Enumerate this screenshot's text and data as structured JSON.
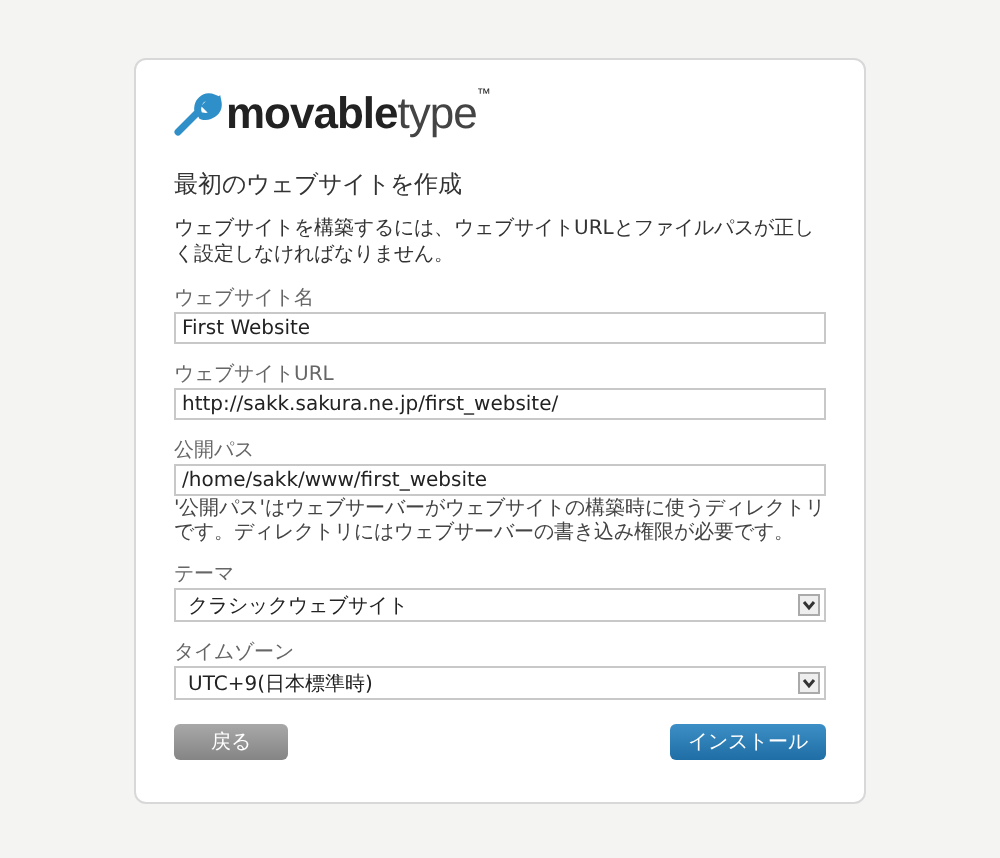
{
  "logo": {
    "strong": "movable",
    "light": "type",
    "mark": "™"
  },
  "heading": "最初のウェブサイトを作成",
  "intro": "ウェブサイトを構築するには、ウェブサイトURLとファイルパスが正しく設定しなければなりません。",
  "fields": [
    {
      "kind": "text",
      "label": "ウェブサイト名",
      "value": "First Website"
    },
    {
      "kind": "text",
      "label": "ウェブサイトURL",
      "value": "http://sakk.sakura.ne.jp/first_website/"
    },
    {
      "kind": "text",
      "label": "公開パス",
      "value": "/home/sakk/www/first_website",
      "hint": "'公開パス'はウェブサーバーがウェブサイトの構築時に使うディレクトリです。ディレクトリにはウェブサーバーの書き込み権限が必要です。"
    },
    {
      "kind": "select",
      "label": "テーマ",
      "value": "クラシックウェブサイト"
    },
    {
      "kind": "select",
      "label": "タイムゾーン",
      "value": "UTC+9(日本標準時)"
    }
  ],
  "buttons": [
    {
      "kind": "secondary",
      "label": "戻る"
    },
    {
      "kind": "primary",
      "label": "インストール"
    }
  ]
}
